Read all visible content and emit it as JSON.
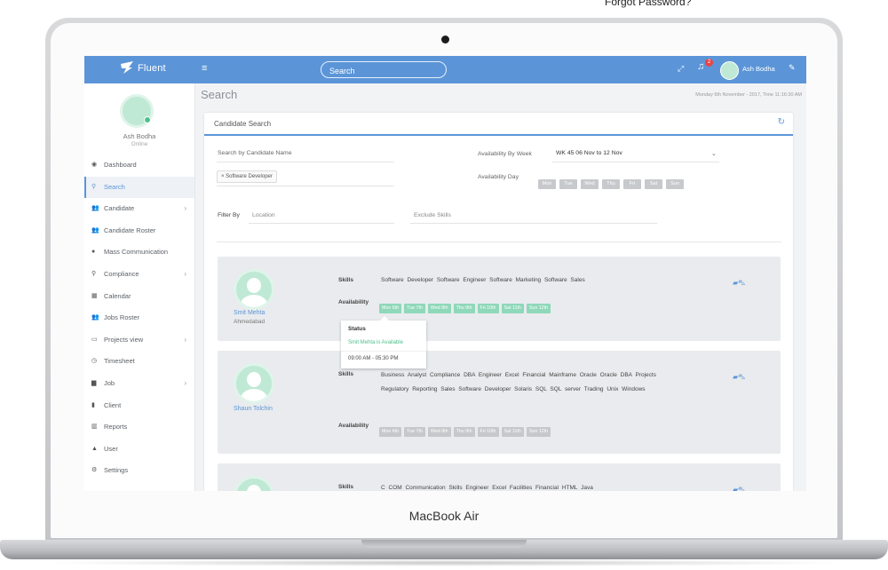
{
  "header_text": "Forgot Password?",
  "device": {
    "brand": "MacBook Air"
  },
  "app": {
    "logo": "Fluent",
    "search_placeholder": "Search",
    "notification_count": "2",
    "user_name": "Ash Bodha"
  },
  "sidebar": {
    "user_name": "Ash Bodha",
    "user_status": "Online",
    "items": [
      {
        "label": "Dashboard",
        "icon": "dashboard-icon",
        "glyph": "◉",
        "arrow": ""
      },
      {
        "label": "Search",
        "icon": "search-icon",
        "glyph": "⚲",
        "arrow": ""
      },
      {
        "label": "Candidate",
        "icon": "users-icon",
        "glyph": "👥",
        "arrow": "›"
      },
      {
        "label": "Candidate Roster",
        "icon": "users-icon",
        "glyph": "👥",
        "arrow": ""
      },
      {
        "label": "Mass Communication",
        "icon": "chat-icon",
        "glyph": "●",
        "arrow": ""
      },
      {
        "label": "Compliance",
        "icon": "pin-icon",
        "glyph": "⚲",
        "arrow": "›"
      },
      {
        "label": "Calendar",
        "icon": "calendar-icon",
        "glyph": "▦",
        "arrow": ""
      },
      {
        "label": "Jobs Roster",
        "icon": "users-icon",
        "glyph": "👥",
        "arrow": ""
      },
      {
        "label": "Projects view",
        "icon": "folder-icon",
        "glyph": "▭",
        "arrow": "›"
      },
      {
        "label": "Timesheet",
        "icon": "clock-icon",
        "glyph": "◷",
        "arrow": ""
      },
      {
        "label": "Job",
        "icon": "briefcase-icon",
        "glyph": "▆",
        "arrow": "›"
      },
      {
        "label": "Client",
        "icon": "building-icon",
        "glyph": "▮",
        "arrow": ""
      },
      {
        "label": "Reports",
        "icon": "bar-chart-icon",
        "glyph": "▥",
        "arrow": ""
      },
      {
        "label": "User",
        "icon": "user-icon",
        "glyph": "▲",
        "arrow": ""
      },
      {
        "label": "Settings",
        "icon": "gear-icon",
        "glyph": "⚙",
        "arrow": ""
      }
    ],
    "active_index": 1
  },
  "main": {
    "title": "Search",
    "datetime": "Monday 6th November - 2017, Time 11:16:30 AM"
  },
  "candidate_search": {
    "title": "Candidate Search",
    "search_by_name_label": "Search by Candidate Name",
    "skill_chip": "× Software Developer",
    "availability_by_week_label": "Availability By Week",
    "week_value": "WK 45   06 Nov to 12 Nov",
    "availability_day_label": "Availability Day",
    "days": [
      "Mon",
      "Tue",
      "Wed",
      "Thu",
      "Fri",
      "Sat",
      "Sun"
    ],
    "filter_by_label": "Filter By",
    "location_placeholder": "Location",
    "exclude_skills_placeholder": "Exclude Skills"
  },
  "results": [
    {
      "name": "Smit Mehta",
      "city": "Ahmedabad",
      "skills_label": "Skills",
      "skills": "Software Developer   Software Engineer   Software Marketing   Software Sales",
      "availability_label": "Availability",
      "availability": [
        "Mon 6th",
        "Tue 7th",
        "Wed 8th",
        "Thu 9th",
        "Fri 10th",
        "Sat 11th",
        "Sun 12th"
      ],
      "available": true
    },
    {
      "name": "Shaun Tolchin",
      "city": "",
      "skills_label": "Skills",
      "skills": "Business Analyst   Compliance   DBA   Engineer   Excel   Financial   Mainframe   Oracle   Oracle DBA   Projects   Regulatory Reporting   Sales   Software Developer   Solaris   SQL   SQL server   Trading   Unix   Windows",
      "availability_label": "Availability",
      "availability": [
        "Mon 6th",
        "Tue 7th",
        "Wed 8th",
        "Thu 9th",
        "Fri 10th",
        "Sat 11th",
        "Sun 12th"
      ],
      "available": false
    },
    {
      "name": "",
      "city": "",
      "skills_label": "Skills",
      "skills": "C   COM   Communication Skills   Engineer   Excel   Facilities   Financial   HTML   Java",
      "availability_label": "",
      "availability": [],
      "available": false
    }
  ],
  "tooltip": {
    "title": "Status",
    "status": "Smit Mehta is Available",
    "time": "09:00 AM - 05:30 PM"
  },
  "colors": {
    "primary": "#5b95d8",
    "available": "#8fd8b9",
    "unavailable": "#c6c8cb",
    "online": "#4fc08d"
  }
}
